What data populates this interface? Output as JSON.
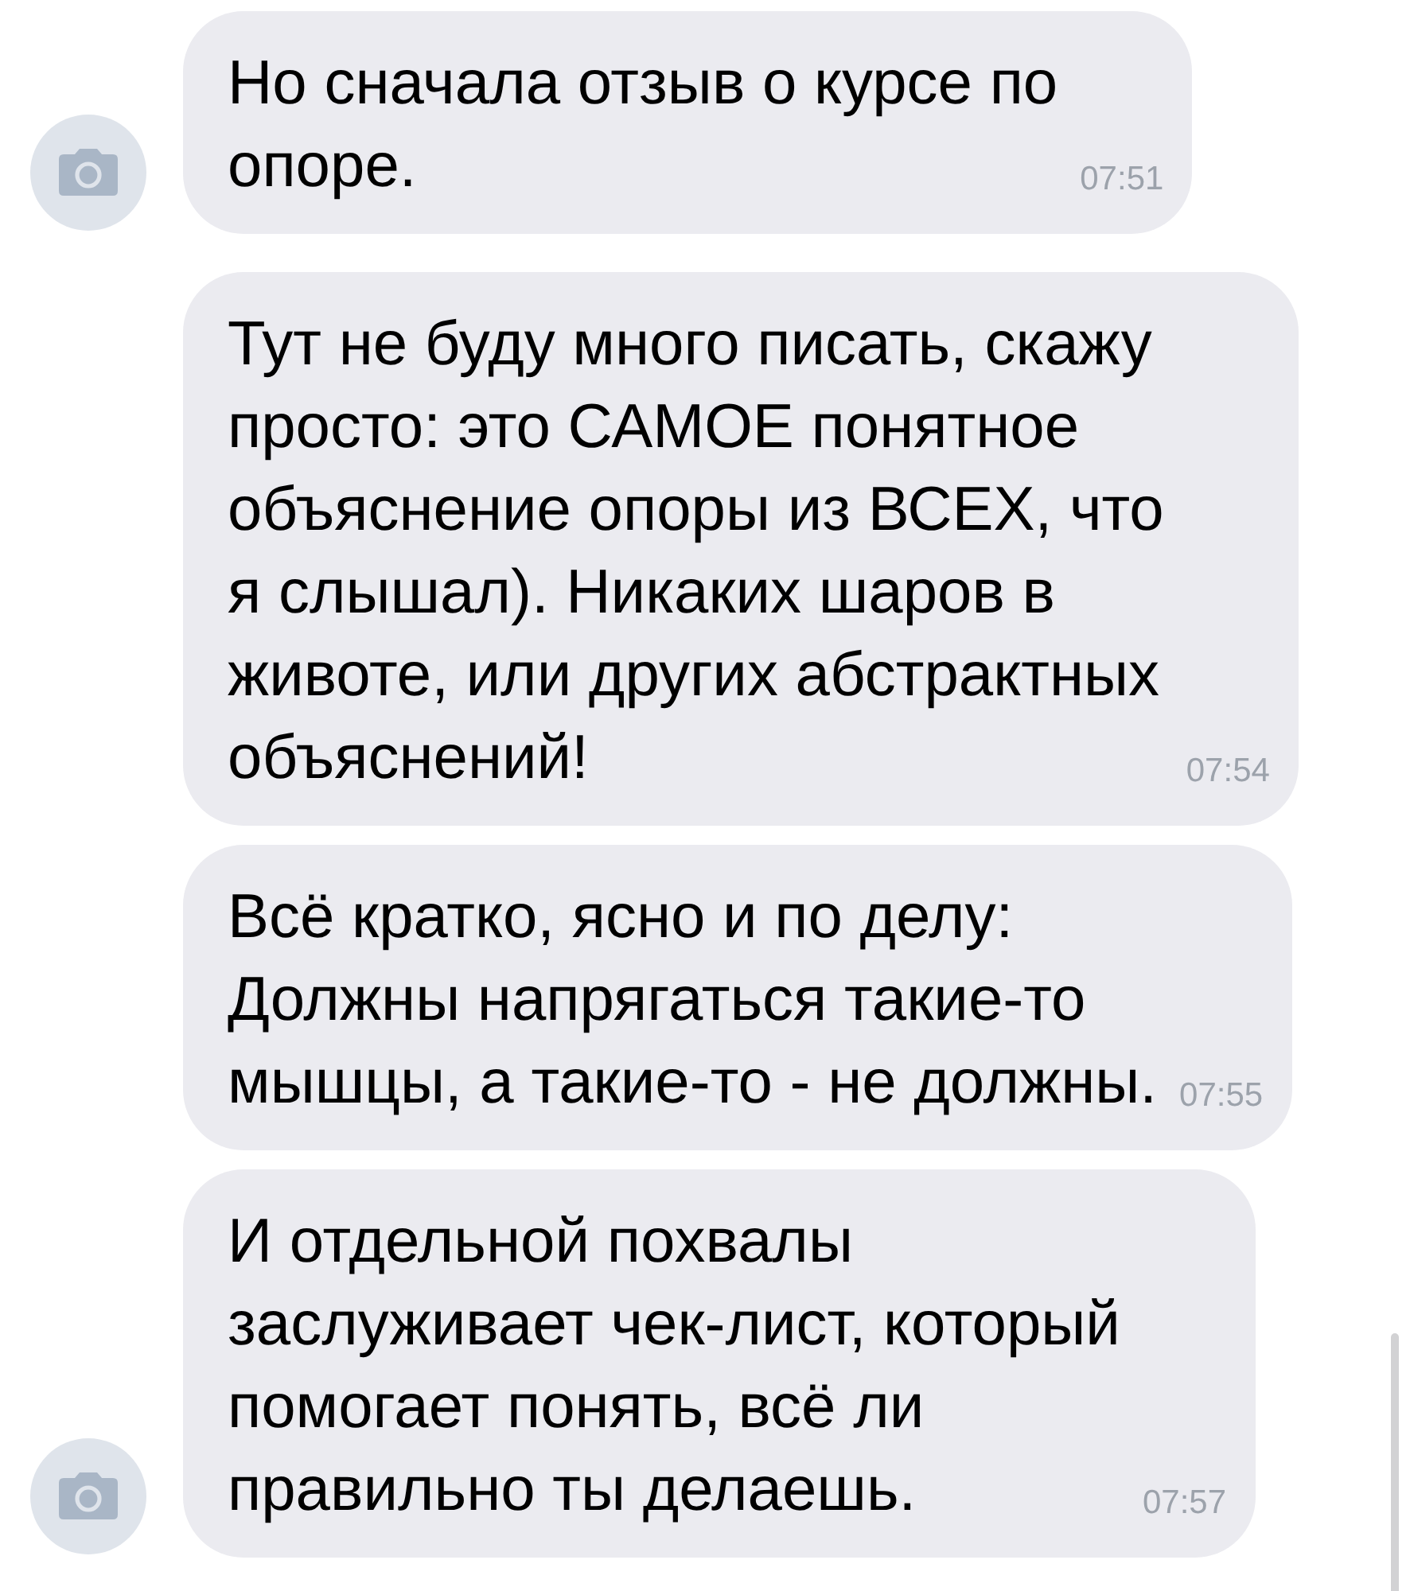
{
  "messages": [
    {
      "text": "Но сначала отзыв о курсе по\nопоре.",
      "time": "07:51",
      "avatar": true
    },
    {
      "text": "Тут не буду много писать, скажу\nпросто: это САМОЕ понятное\nобъяснение опоры из ВСЕХ, что\nя слышал). Никаких шаров в\nживоте, или других абстрактных\nобъяснений!",
      "time": "07:54",
      "avatar": false
    },
    {
      "text": "Всё кратко, ясно и по делу:\nДолжны напрягаться такие-то\nмышцы, а такие-то - не должны.",
      "time": "07:55",
      "avatar": false
    },
    {
      "text": "И отдельной похвалы\nзаслуживает чек-лист, который\nпомогает понять, всё ли\nправильно ты делаешь.",
      "time": "07:57",
      "avatar": true
    }
  ]
}
